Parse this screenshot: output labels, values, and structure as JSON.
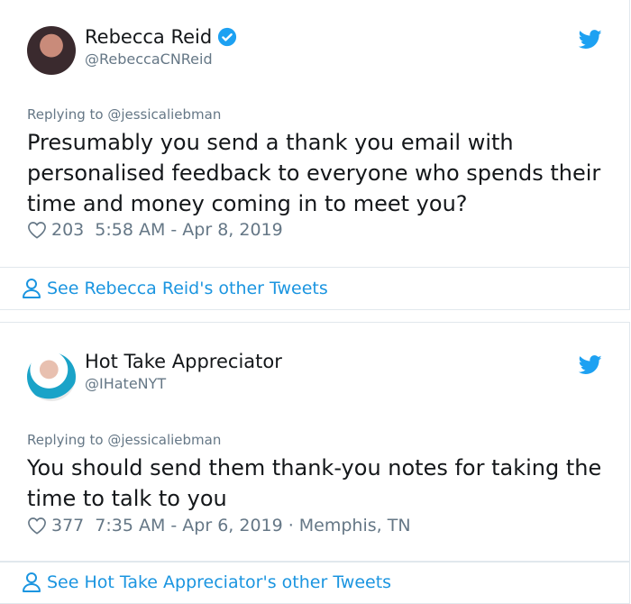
{
  "tweets": [
    {
      "name": "Rebecca Reid",
      "handle": "@RebeccaCNReid",
      "verified": true,
      "replying": "Replying to @jessicaliebman",
      "text": "Presumably you send a thank you email with personalised feedback to everyone who spends their time and money coming in to meet you?",
      "likes": "203",
      "timestamp": "5:58 AM - Apr 8, 2019",
      "location": "",
      "footer_link": "See Rebecca Reid's other Tweets"
    },
    {
      "name": "Hot Take Appreciator",
      "handle": "@IHateNYT",
      "verified": false,
      "replying": "Replying to @jessicaliebman",
      "text": "You should send them thank-you notes for taking the time to talk to you",
      "likes": "377",
      "timestamp": "7:35 AM - Apr 6, 2019",
      "location": "Memphis, TN",
      "footer_link": "See Hot Take Appreciator's other Tweets"
    }
  ],
  "icons": {
    "bird": "twitter-bird-icon",
    "verified": "verified-badge-icon",
    "heart": "heart-outline-icon",
    "person": "person-outline-icon"
  },
  "colors": {
    "accent": "#1da1f2",
    "link": "#1b95e0",
    "secondary_text": "#657786",
    "border": "#e1e8ed"
  }
}
